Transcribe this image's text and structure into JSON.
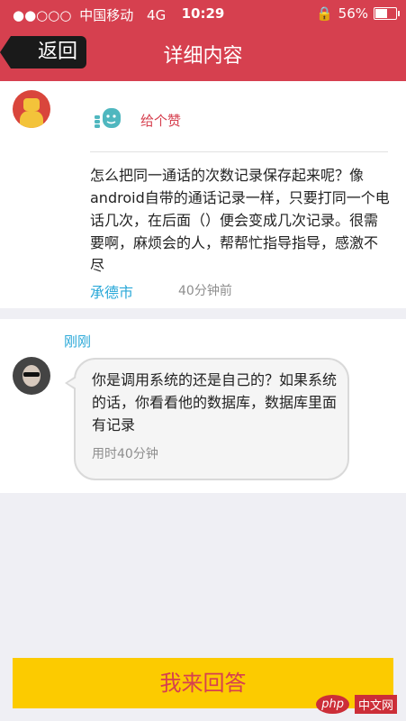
{
  "status_bar": {
    "signal": "●●○○○",
    "carrier": "中国移动",
    "network": "4G",
    "time": "10:29",
    "lock": "🔒",
    "battery": "56%",
    "battery_level": 0.56
  },
  "nav": {
    "back_label": "返回",
    "title": "详细内容"
  },
  "question": {
    "like_label": "给个赞",
    "text": "怎么把同一通话的次数记录保存起来呢？像android自带的通话记录一样，只要打同一个电话几次，在后面（）便会变成几次记录。很需要啊，麻烦会的人，帮帮忙指导指导，感激不尽",
    "city": "承德市",
    "time": "40分钟前"
  },
  "answer": {
    "user": "刚刚",
    "text": "你是调用系统的还是自己的？如果系统的话，你看看他的数据库，数据库里面有记录",
    "duration": "用时40分钟"
  },
  "footer": {
    "answer_button": "我来回答"
  },
  "watermark": {
    "logo": "php",
    "text": "中文网"
  },
  "colors": {
    "header": "#d6404f",
    "accent_blue": "#2aa8d8",
    "button": "#fccb00"
  }
}
